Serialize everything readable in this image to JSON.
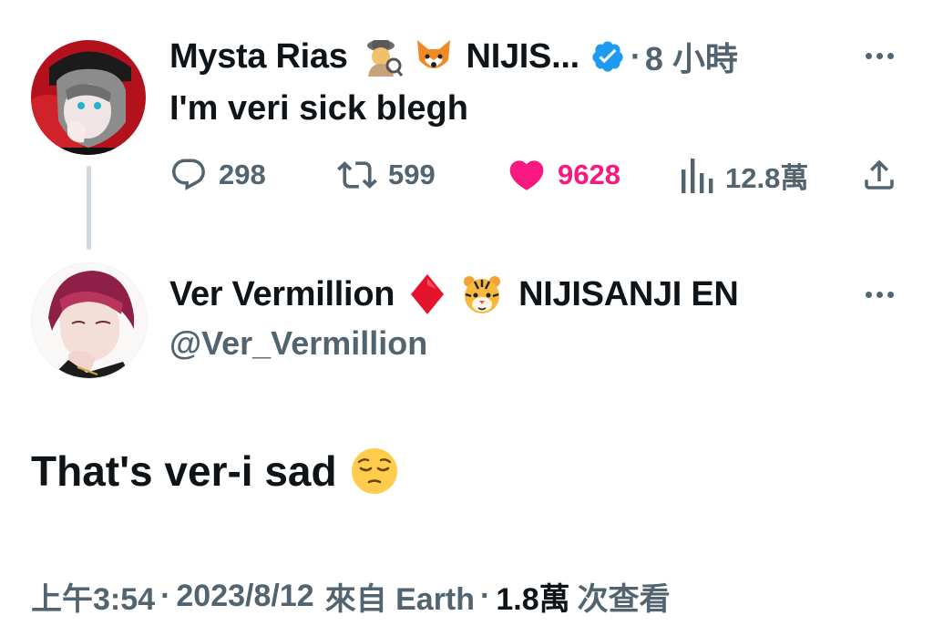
{
  "parent_tweet": {
    "display_name": "Mysta Rias",
    "name_suffix": "NIJIS...",
    "emojis": [
      "detective-emoji",
      "fox-emoji"
    ],
    "verified": true,
    "separator": "·",
    "time_ago": "8 小時",
    "text": "I'm veri sick blegh",
    "replies": "298",
    "retweets": "599",
    "likes": "9628",
    "views": "12.8萬",
    "liked": true
  },
  "reply_tweet": {
    "display_name": "Ver Vermillion",
    "name_suffix": "NIJISANJI EN",
    "emojis": [
      "red-diamond-emoji",
      "tiger-emoji"
    ],
    "handle": "@Ver_Vermillion",
    "text": "That's ver-i sad",
    "text_emoji": "pensive-face-emoji"
  },
  "footer": {
    "time": "上午3:54",
    "date": "2023/8/12",
    "source": "來自 Earth",
    "views_count": "1.8萬",
    "views_label": "次查看",
    "separator": "·"
  },
  "colors": {
    "text_primary": "#0f1419",
    "text_secondary": "#536471",
    "like_pink": "#f91880",
    "verified_blue": "#1d9bf0",
    "thread_line": "#cfd9de"
  }
}
